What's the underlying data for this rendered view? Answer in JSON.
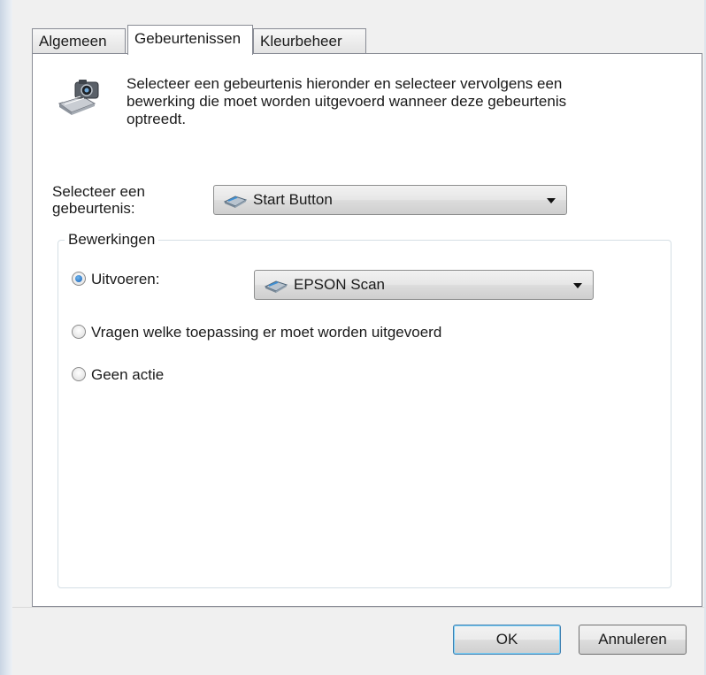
{
  "tabs": [
    {
      "label": "Algemeen",
      "active": false
    },
    {
      "label": "Gebeurtenissen",
      "active": true
    },
    {
      "label": "Kleurbeheer",
      "active": false
    }
  ],
  "info": {
    "icon": "scanner-camera-icon",
    "text": "Selecteer een gebeurtenis hieronder en selecteer vervolgens een bewerking die moet worden uitgevoerd wanneer deze gebeurtenis optreedt."
  },
  "event": {
    "label": "Selecteer een gebeurtenis:",
    "selected": "Start Button",
    "icon": "scanner-icon"
  },
  "actions": {
    "title": "Bewerkingen",
    "run_label": "Uitvoeren:",
    "run_selected": true,
    "run_app": "EPSON Scan",
    "run_app_icon": "scanner-icon",
    "ask_label": "Vragen welke toepassing er moet worden uitgevoerd",
    "none_label": "Geen actie"
  },
  "buttons": {
    "ok": "OK",
    "cancel": "Annuleren"
  }
}
